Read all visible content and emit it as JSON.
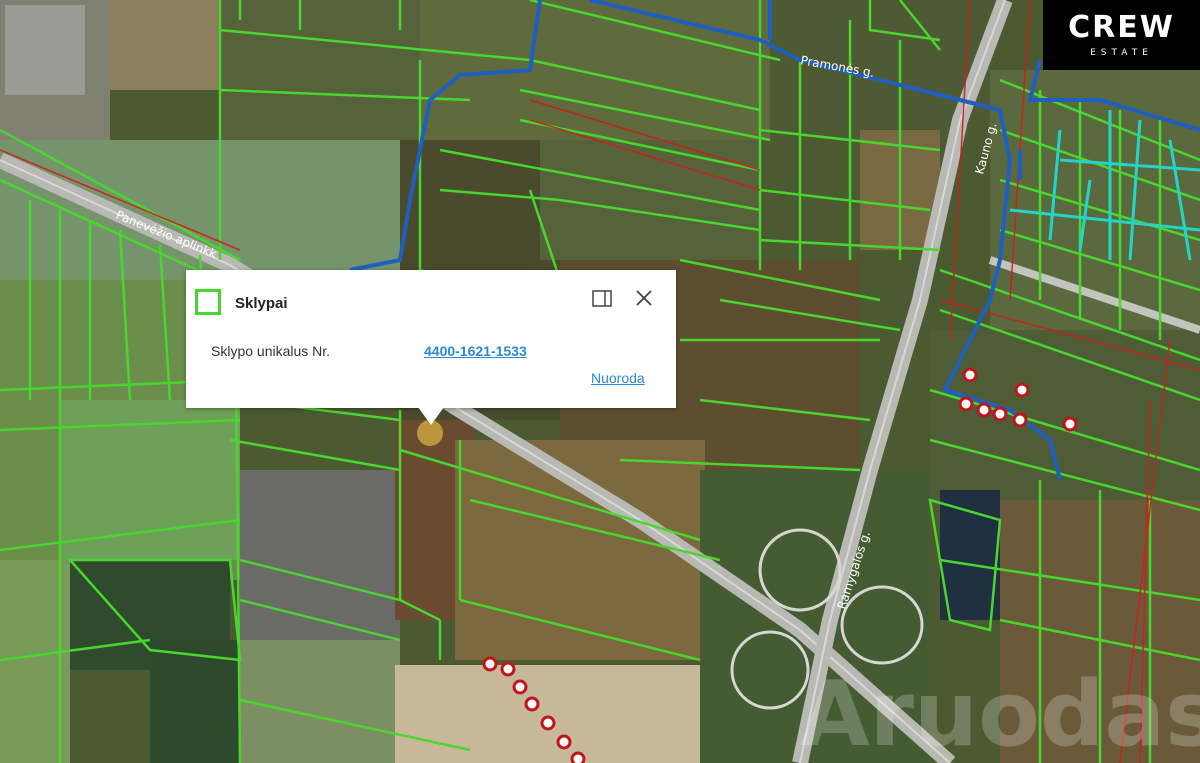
{
  "popup": {
    "title": "Sklypai",
    "field_label": "Sklypo unikalus Nr.",
    "field_value": "4400-1621-1533",
    "link": "Nuoroda"
  },
  "logo": {
    "main": "CREW",
    "sub": "ESTATE"
  },
  "map_labels": {
    "road_1": "Panevėžio aplinkk",
    "road_2": "Ramygalos g.",
    "road_3": "Pramonės g.",
    "road_4": "Kauno g.",
    "watermark": "Aruodas"
  },
  "icons": {
    "parcel_legend": "square-outline-icon",
    "dock": "dock-panel-icon",
    "close": "close-icon"
  },
  "colors": {
    "parcel_boundary": "#49d62e",
    "water_main": "#1f5fbf",
    "water_branch": "#25d4c8",
    "power_line": "#d01c1c",
    "link": "#2a8ad4"
  }
}
